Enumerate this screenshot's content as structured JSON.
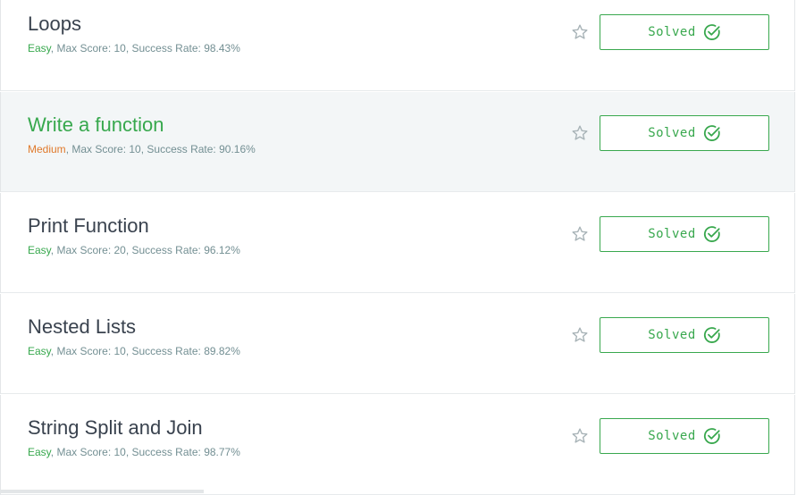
{
  "challenges": [
    {
      "title": "Loops",
      "difficulty": "Easy",
      "difficulty_class": "diff-easy",
      "rest": ", Max Score: 10, Success Rate: 98.43%",
      "status": "Solved"
    },
    {
      "title": "Write a function",
      "difficulty": "Medium",
      "difficulty_class": "diff-medium",
      "rest": ", Max Score: 10, Success Rate: 90.16%",
      "status": "Solved"
    },
    {
      "title": "Print Function",
      "difficulty": "Easy",
      "difficulty_class": "diff-easy",
      "rest": ", Max Score: 20, Success Rate: 96.12%",
      "status": "Solved"
    },
    {
      "title": "Nested Lists",
      "difficulty": "Easy",
      "difficulty_class": "diff-easy",
      "rest": ", Max Score: 10, Success Rate: 89.82%",
      "status": "Solved"
    },
    {
      "title": "String Split and Join",
      "difficulty": "Easy",
      "difficulty_class": "diff-easy",
      "rest": ", Max Score: 10, Success Rate: 98.77%",
      "status": "Solved"
    }
  ],
  "icons": {
    "bookmark": "star-outline-icon",
    "solved": "check-circle-icon"
  },
  "colors": {
    "accent": "#39a84e",
    "easy": "#37a84d",
    "medium": "#e07a2c",
    "hover_bg": "#f3f6f7",
    "text": "#39424e",
    "meta": "#738f93"
  }
}
